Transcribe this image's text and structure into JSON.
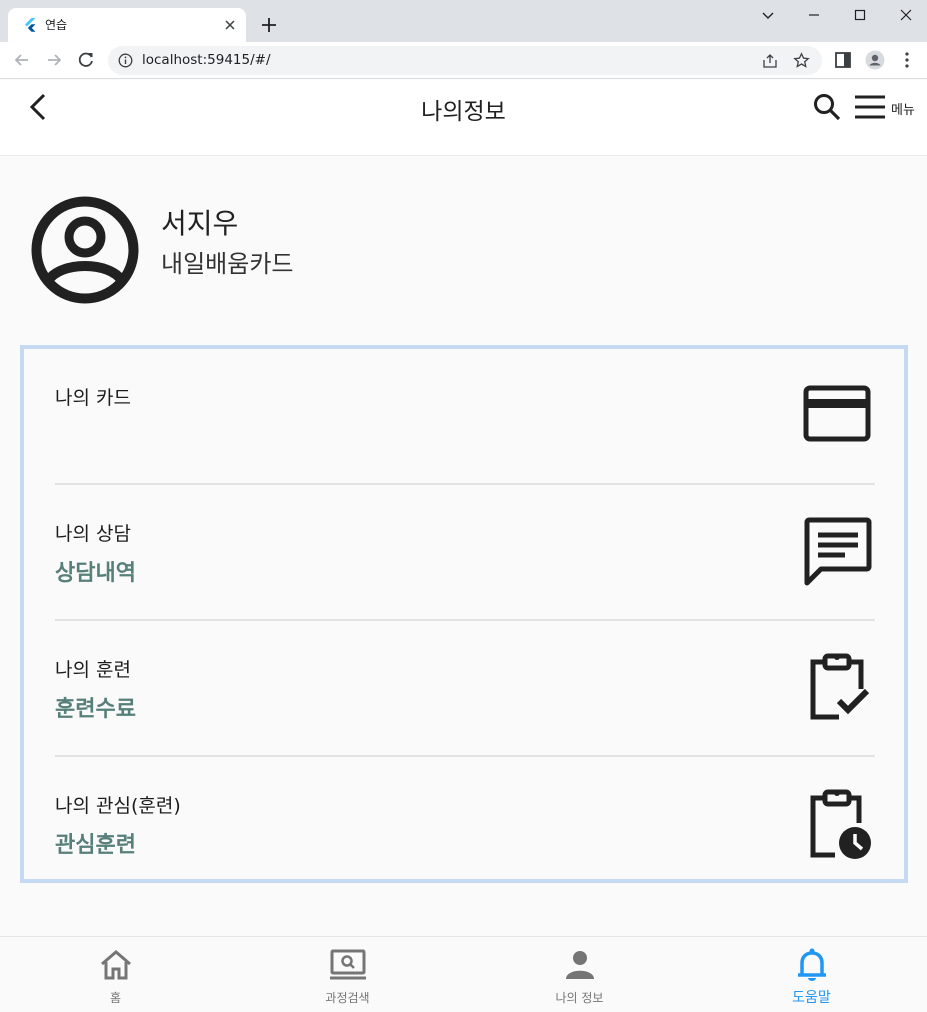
{
  "browser": {
    "tab_title": "연습",
    "url": "localhost:59415/#/"
  },
  "appbar": {
    "title": "나의정보",
    "menu_label": "메뉴"
  },
  "profile": {
    "name": "서지우",
    "card_type": "내일배움카드"
  },
  "items": [
    {
      "title": "나의 카드",
      "subtitle": "",
      "icon": "credit-card-icon"
    },
    {
      "title": "나의 상담",
      "subtitle": "상담내역",
      "icon": "message-icon"
    },
    {
      "title": "나의 훈련",
      "subtitle": "훈련수료",
      "icon": "clipboard-check-icon"
    },
    {
      "title": "나의 관심(훈련)",
      "subtitle": "관심훈련",
      "icon": "clipboard-clock-icon"
    }
  ],
  "bottom_nav": [
    {
      "label": "홈",
      "icon": "home-icon",
      "active": false
    },
    {
      "label": "과정검색",
      "icon": "laptop-search-icon",
      "active": false
    },
    {
      "label": "나의 정보",
      "icon": "person-icon",
      "active": false
    },
    {
      "label": "도움말",
      "icon": "bell-icon",
      "active": true
    }
  ],
  "colors": {
    "accent": "#2196f3",
    "subtitle": "#58807a",
    "panel_border": "#c5d9f2"
  }
}
